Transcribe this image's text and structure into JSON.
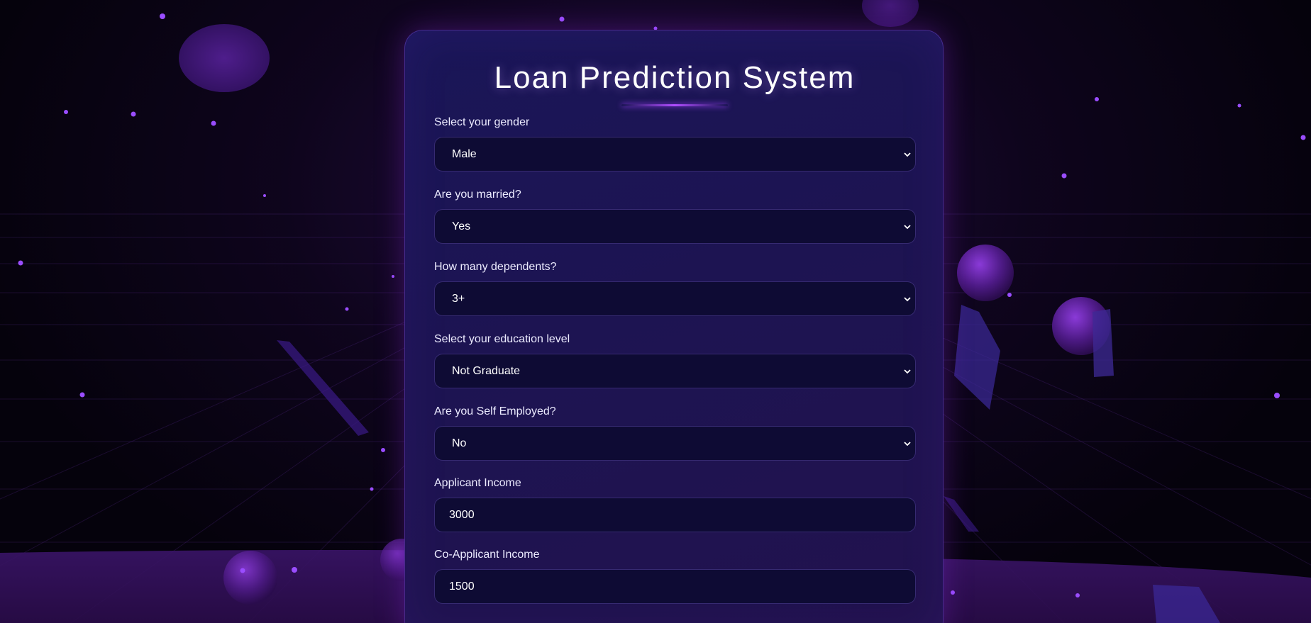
{
  "app": {
    "title": "Loan Prediction System"
  },
  "form": {
    "fields": [
      {
        "label": "Select your gender",
        "type": "select",
        "value": "Male"
      },
      {
        "label": "Are you married?",
        "type": "select",
        "value": "Yes"
      },
      {
        "label": "How many dependents?",
        "type": "select",
        "value": "3+"
      },
      {
        "label": "Select your education level",
        "type": "select",
        "value": "Not Graduate"
      },
      {
        "label": "Are you Self Employed?",
        "type": "select",
        "value": "No"
      },
      {
        "label": "Applicant Income",
        "type": "input",
        "value": "3000"
      },
      {
        "label": "Co-Applicant Income",
        "type": "input",
        "value": "1500"
      }
    ]
  },
  "colors": {
    "card_background": "#1b1555",
    "control_background": "#0e0b34",
    "accent": "#b04dff",
    "text": "#ffffff"
  },
  "icons": {
    "select_arrow": "chevron-down-icon"
  }
}
